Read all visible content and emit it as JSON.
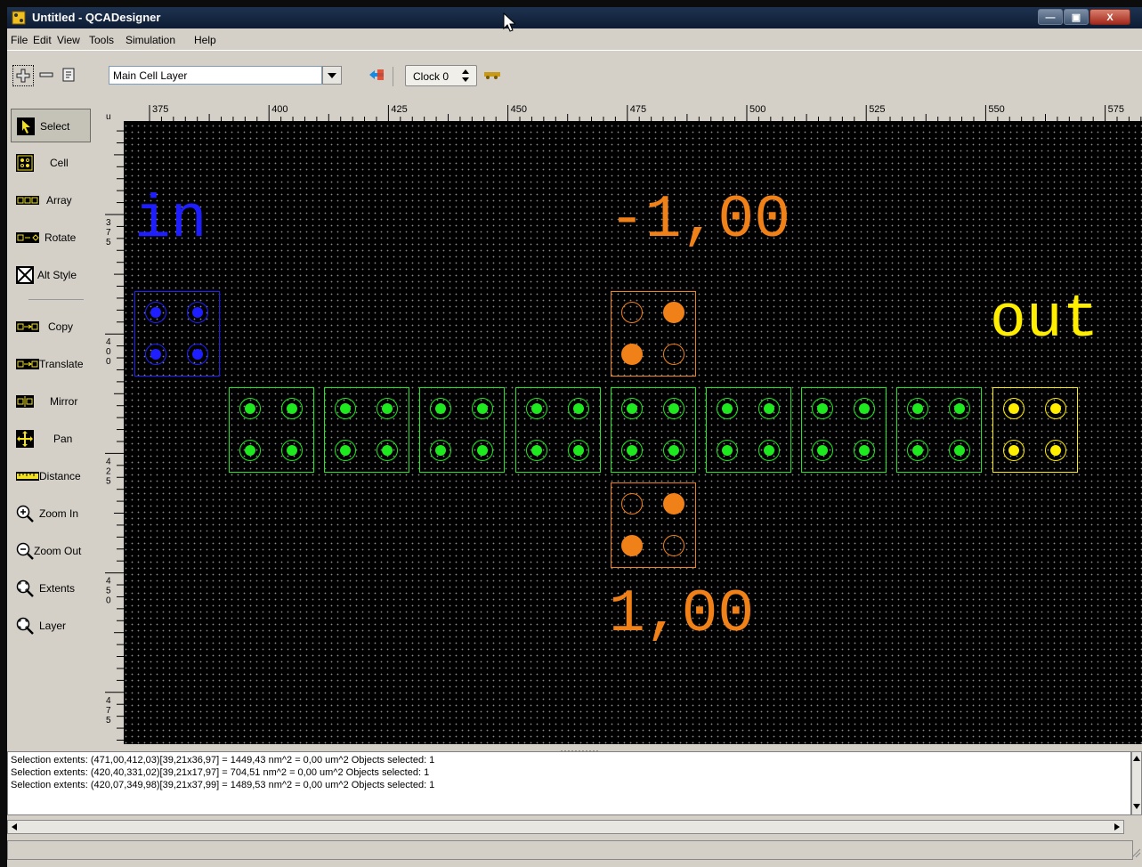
{
  "window": {
    "title": "Untitled - QCADesigner",
    "controls": {
      "minimize": "—",
      "maximize": "▣",
      "close": "X"
    }
  },
  "menu": [
    "File",
    "Edit",
    "View",
    "Tools",
    "Simulation",
    "Help"
  ],
  "toolbar": {
    "layer_combo_value": "Main Cell Layer",
    "clock_value": "Clock 0"
  },
  "tools": [
    {
      "label": "Select",
      "icon": "pointer-icon"
    },
    {
      "label": "Cell",
      "icon": "cell-icon"
    },
    {
      "label": "Array",
      "icon": "array-icon"
    },
    {
      "label": "Rotate",
      "icon": "rotate-icon"
    },
    {
      "label": "Alt Style",
      "icon": "alt-style-icon"
    },
    {
      "label": "Copy",
      "icon": "copy-icon"
    },
    {
      "label": "Translate",
      "icon": "translate-icon"
    },
    {
      "label": "Mirror",
      "icon": "mirror-icon"
    },
    {
      "label": "Pan",
      "icon": "pan-icon"
    },
    {
      "label": "Distance",
      "icon": "ruler-icon"
    },
    {
      "label": "Zoom In",
      "icon": "zoom-in-icon"
    },
    {
      "label": "Zoom Out",
      "icon": "zoom-out-icon"
    },
    {
      "label": "Extents",
      "icon": "zoom-extents-icon"
    },
    {
      "label": "Layer",
      "icon": "zoom-layer-icon"
    }
  ],
  "ruler": {
    "horizontal_labels": [
      "375",
      "400",
      "425",
      "450",
      "475",
      "500",
      "525",
      "550",
      "575"
    ],
    "vertical_labels": [
      "375",
      "400",
      "425",
      "450",
      "475"
    ],
    "corner": "u"
  },
  "design": {
    "labels": {
      "input": "in",
      "output": "out",
      "fixed_top": "-1,00",
      "fixed_bottom": "1,00"
    },
    "colors": {
      "input": "#1e1eff",
      "output": "#ffee00",
      "fixed": "#f08018",
      "normal": "#1ee81e"
    },
    "polarity_top": -1.0,
    "polarity_bottom": 1.0
  },
  "log": [
    "Selection extents: (471,00,412,03)[39,21x36,97] = 1449,43 nm^2 = 0,00 um^2 Objects selected: 1",
    "Selection extents: (420,40,331,02)[39,21x17,97] = 704,51 nm^2 = 0,00 um^2 Objects selected: 1",
    "Selection extents: (420,07,349,98)[39,21x37,99] = 1489,53 nm^2 = 0,00 um^2 Objects selected: 1"
  ],
  "statusbar": {
    "text": ""
  }
}
